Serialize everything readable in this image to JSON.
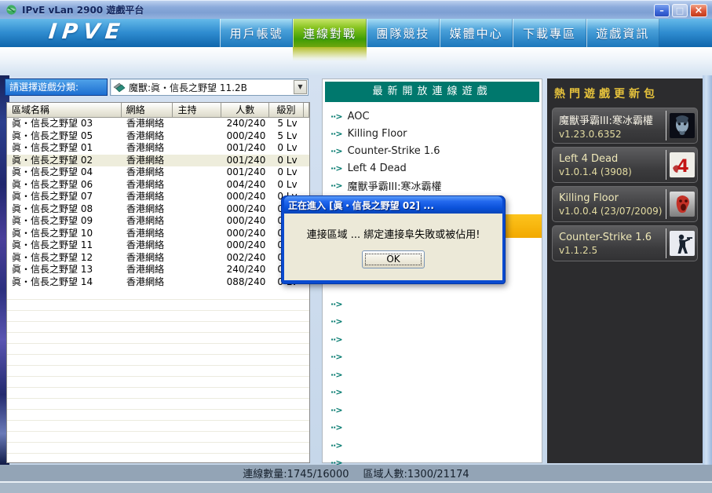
{
  "window": {
    "title": "IPvE vLan 2900 遊戲平台",
    "controls": {
      "minimize": "–",
      "maximize": "□",
      "close": "×"
    }
  },
  "nav": {
    "logo_text": "IPVE",
    "active_tab": "連線對戰",
    "tabs": [
      "用戶帳號",
      "連線對戰",
      "團隊競技",
      "媒體中心",
      "下載專區",
      "遊戲資訊"
    ]
  },
  "filter": {
    "label": "請選擇遊戲分類:",
    "selected": "魔獸:眞・信長之野望 11.2B"
  },
  "room_table": {
    "columns": [
      "區域名稱",
      "網絡",
      "主持",
      "人數",
      "級別"
    ],
    "rows": [
      {
        "name": "眞・信長之野望 03",
        "network": "香港網絡",
        "host": "",
        "players": "240/240",
        "level": "5 Lv",
        "selected": false
      },
      {
        "name": "眞・信長之野望 05",
        "network": "香港網絡",
        "host": "",
        "players": "000/240",
        "level": "5 Lv",
        "selected": false
      },
      {
        "name": "眞・信長之野望 01",
        "network": "香港網絡",
        "host": "",
        "players": "001/240",
        "level": "0 Lv",
        "selected": false
      },
      {
        "name": "眞・信長之野望 02",
        "network": "香港網絡",
        "host": "",
        "players": "001/240",
        "level": "0 Lv",
        "selected": true
      },
      {
        "name": "眞・信長之野望 04",
        "network": "香港網絡",
        "host": "",
        "players": "001/240",
        "level": "0 Lv",
        "selected": false
      },
      {
        "name": "眞・信長之野望 06",
        "network": "香港網絡",
        "host": "",
        "players": "004/240",
        "level": "0 Lv",
        "selected": false
      },
      {
        "name": "眞・信長之野望 07",
        "network": "香港網絡",
        "host": "",
        "players": "000/240",
        "level": "0 Lv",
        "selected": false
      },
      {
        "name": "眞・信長之野望 08",
        "network": "香港網絡",
        "host": "",
        "players": "000/240",
        "level": "0 Lv",
        "selected": false
      },
      {
        "name": "眞・信長之野望 09",
        "network": "香港網絡",
        "host": "",
        "players": "000/240",
        "level": "0 Lv",
        "selected": false
      },
      {
        "name": "眞・信長之野望 10",
        "network": "香港網絡",
        "host": "",
        "players": "000/240",
        "level": "0 Lv",
        "selected": false
      },
      {
        "name": "眞・信長之野望 11",
        "network": "香港網絡",
        "host": "",
        "players": "000/240",
        "level": "0 Lv",
        "selected": false
      },
      {
        "name": "眞・信長之野望 12",
        "network": "香港網絡",
        "host": "",
        "players": "002/240",
        "level": "0 Lv",
        "selected": false
      },
      {
        "name": "眞・信長之野望 13",
        "network": "香港網絡",
        "host": "",
        "players": "240/240",
        "level": "0 Lv",
        "selected": false
      },
      {
        "name": "眞・信長之野望 14",
        "network": "香港網絡",
        "host": "",
        "players": "088/240",
        "level": "0 Lv",
        "selected": false
      }
    ]
  },
  "games_panel": {
    "title": "最新開放連線遊戲",
    "items": [
      {
        "label": "AOC"
      },
      {
        "label": "Killing Floor"
      },
      {
        "label": "Counter-Strike 1.6"
      },
      {
        "label": "Left 4 Dead"
      },
      {
        "label": "魔獸爭霸III:寒冰霸權"
      }
    ],
    "empty_items": [
      "",
      "",
      "",
      "",
      "",
      "",
      "",
      "",
      "",
      ""
    ]
  },
  "dialog": {
    "title": "正在進入 [眞・信長之野望 02] ...",
    "message": "連接區域 ... 綁定連接阜失敗或被佔用!",
    "ok_label": "OK"
  },
  "updates_panel": {
    "title": "熱門遊戲更新包",
    "cards": [
      {
        "title": "魔獸爭霸III:寒冰霸權",
        "version": "v1.23.0.6352",
        "icon": "warcraft3-icon"
      },
      {
        "title": "Left 4 Dead",
        "version": "v1.0.1.4 (3908)",
        "icon": "left4dead-icon"
      },
      {
        "title": "Killing Floor",
        "version": "v1.0.0.4 (23/07/2009)",
        "icon": "killing-floor-icon"
      },
      {
        "title": "Counter-Strike 1.6",
        "version": "v1.1.2.5",
        "icon": "counter-strike-icon"
      }
    ]
  },
  "status_bar": {
    "connections": "連線數量:1745/16000",
    "players": "區域人數:1300/21174"
  },
  "colors": {
    "active_tab_green": "#3f9d05",
    "panel_teal": "#00786d",
    "sidebar_gold": "#e6c23c",
    "highlight_yellow": "#f7b500",
    "dialog_blue": "#0a50d8"
  }
}
